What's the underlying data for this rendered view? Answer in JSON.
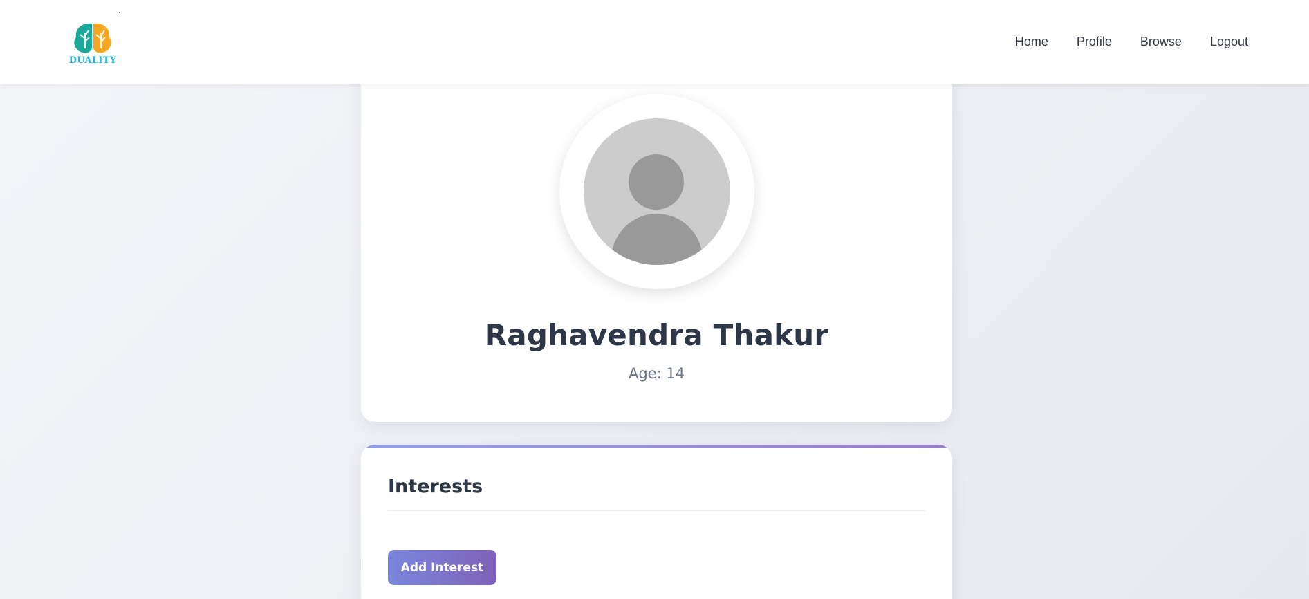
{
  "brand": {
    "name": "DUALITY",
    "colors": {
      "left_leaf": "#1aa89b",
      "right_leaf": "#f5a623",
      "wordmark": "#1fb6e0"
    }
  },
  "nav": {
    "items": [
      {
        "label": "Home"
      },
      {
        "label": "Profile"
      },
      {
        "label": "Browse"
      },
      {
        "label": "Logout"
      }
    ]
  },
  "profile": {
    "name": "Raghavendra Thakur",
    "age": "Age: 14",
    "avatar_icon": "default-user-icon"
  },
  "interests": {
    "title": "Interests",
    "add_button_label": "Add Interest",
    "accent_gradient": [
      "#7986dc",
      "#7f62b8"
    ]
  }
}
